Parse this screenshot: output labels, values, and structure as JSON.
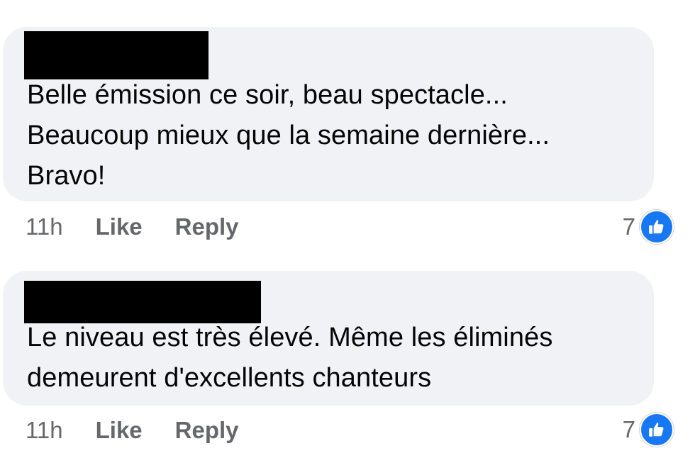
{
  "comments": [
    {
      "text_lines": [
        "Belle émission ce soir, beau spectacle...",
        "Beaucoup mieux que la semaine dernière...",
        "Bravo!"
      ],
      "timestamp": "11h",
      "like_label": "Like",
      "reply_label": "Reply",
      "reaction_count": "7",
      "reaction_icon": "thumbs-up-icon"
    },
    {
      "text_lines": [
        "Le niveau est très élevé. Même les éliminés",
        "demeurent d'excellents chanteurs"
      ],
      "timestamp": "11h",
      "like_label": "Like",
      "reply_label": "Reply",
      "reaction_count": "7",
      "reaction_icon": "thumbs-up-icon"
    }
  ],
  "colors": {
    "bubble_background": "#f0f2f5",
    "text": "#050505",
    "meta_text": "#65676b",
    "like_badge": "#1877f2",
    "redaction": "#000000"
  }
}
